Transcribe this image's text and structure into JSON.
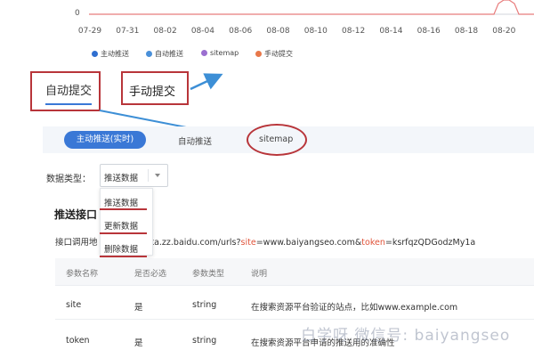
{
  "chart": {
    "y_tick": "0",
    "x_ticks": [
      "07-29",
      "07-31",
      "08-02",
      "08-04",
      "08-06",
      "08-08",
      "08-10",
      "08-12",
      "08-14",
      "08-16",
      "08-18",
      "08-20"
    ],
    "legend": [
      {
        "label": "主动推送",
        "color": "#2f6fd0"
      },
      {
        "label": "自动推送",
        "color": "#4a90d9"
      },
      {
        "label": "sitemap",
        "color": "#9b6fd0"
      },
      {
        "label": "手动提交",
        "color": "#e8784a"
      }
    ],
    "line_color": "#e87c7c"
  },
  "tabs": {
    "auto_submit": "自动提交",
    "manual_submit": "手动提交"
  },
  "sub_tabs": {
    "active_push": "主动推送(实时)",
    "auto_push": "自动推送",
    "sitemap": "sitemap"
  },
  "data_type": {
    "label": "数据类型：",
    "selected": "推送数据",
    "options": [
      "推送数据",
      "更新数据",
      "删除数据"
    ]
  },
  "push": {
    "title": "推送接口",
    "url_prefix": "接口调用地",
    "url_host": "data.zz.baidu.com/urls?",
    "url_site_key": "site",
    "url_site_val": "=www.baiyangseo.com&",
    "url_token_key": "token",
    "url_token_val": "=ksrfqzQDGodzMy1a"
  },
  "table": {
    "headers": [
      "参数名称",
      "是否必选",
      "参数类型",
      "说明"
    ],
    "rows": [
      {
        "name": "site",
        "required": "是",
        "type": "string",
        "desc": "在搜索资源平台验证的站点，比如www.example.com"
      },
      {
        "name": "token",
        "required": "是",
        "type": "string",
        "desc": "在搜索资源平台申请的推送用的准确性"
      }
    ]
  },
  "watermark": "白学呀 微信号: baiyangseo",
  "colors": {
    "accent": "#3a78d6",
    "annotation": "#b8353a",
    "highlight": "#e0533a"
  }
}
